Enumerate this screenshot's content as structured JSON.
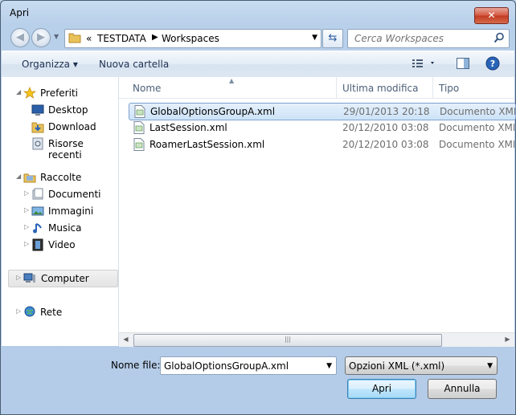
{
  "window": {
    "title": "Apri",
    "close_label": "✕"
  },
  "nav": {
    "back_label": "◀",
    "forward_label": "▶",
    "breadcrumb_prefix": "«",
    "breadcrumb": [
      "TESTDATA",
      "Workspaces"
    ],
    "breadcrumb_sep": "▶",
    "refresh_label": "⇆",
    "search_placeholder": "Cerca Workspaces"
  },
  "toolbar": {
    "organize_label": "Organizza ▾",
    "new_folder_label": "Nuova cartella"
  },
  "sidebar": {
    "favorites": {
      "label": "Preferiti",
      "items": [
        "Desktop",
        "Download",
        "Risorse recenti"
      ]
    },
    "libraries": {
      "label": "Raccolte",
      "items": [
        "Documenti",
        "Immagini",
        "Musica",
        "Video"
      ]
    },
    "computer": "Computer",
    "network": "Rete"
  },
  "columns": {
    "name": "Nome",
    "modified": "Ultima modifica",
    "type": "Tipo"
  },
  "files": [
    {
      "name": "GlobalOptionsGroupA.xml",
      "date": "29/01/2013 20:18",
      "type": "Documento XML",
      "selected": true
    },
    {
      "name": "LastSession.xml",
      "date": "20/12/2010 03:08",
      "type": "Documento XML",
      "selected": false
    },
    {
      "name": "RoamerLastSession.xml",
      "date": "20/12/2010 03:08",
      "type": "Documento XML",
      "selected": false
    }
  ],
  "bottom": {
    "filename_label": "Nome file:",
    "filename_value": "GlobalOptionsGroupA.xml",
    "filter_value": "Opzioni XML (*.xml)",
    "open_label": "Apri",
    "cancel_label": "Annulla"
  }
}
